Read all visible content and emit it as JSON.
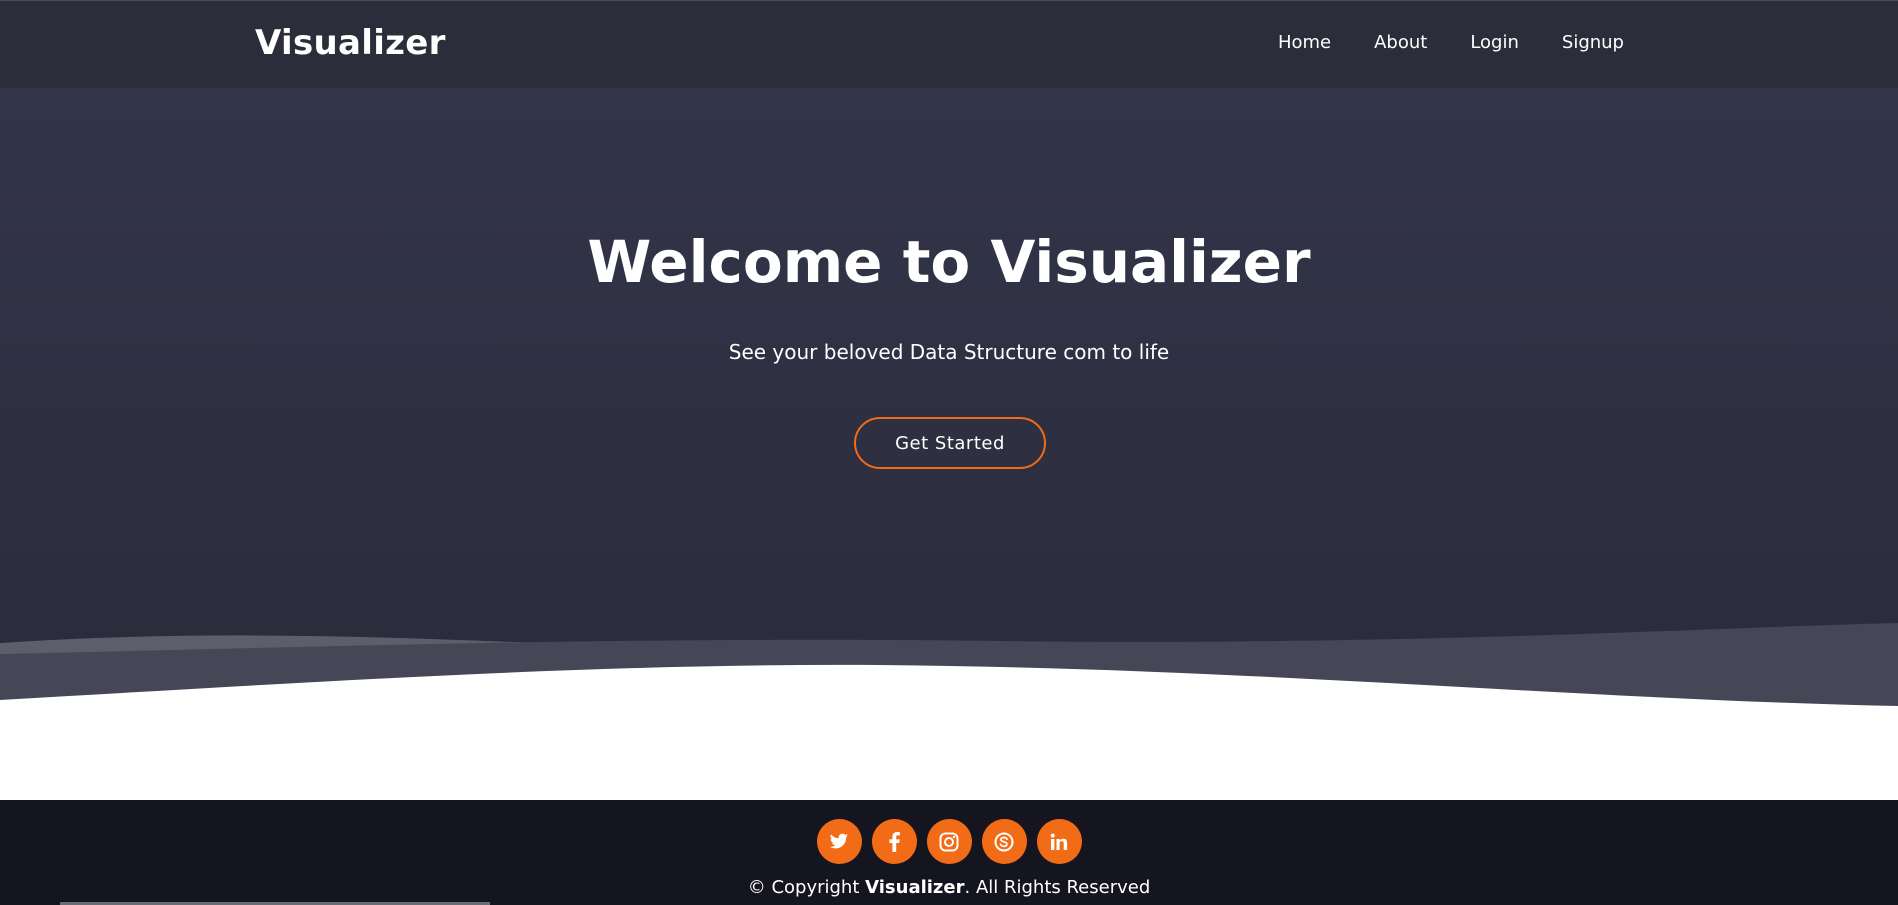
{
  "header": {
    "logo": "Visualizer",
    "nav": [
      {
        "label": "Home"
      },
      {
        "label": "About"
      },
      {
        "label": "Login"
      },
      {
        "label": "Signup"
      }
    ]
  },
  "hero": {
    "title": "Welcome to Visualizer",
    "subtitle": "See your beloved Data Structure com to life",
    "cta_label": "Get Started"
  },
  "footer": {
    "socials": [
      {
        "icon": "twitter-icon"
      },
      {
        "icon": "facebook-icon"
      },
      {
        "icon": "instagram-icon"
      },
      {
        "icon": "skype-icon"
      },
      {
        "icon": "linkedin-icon"
      }
    ],
    "copyright_prefix": "© Copyright ",
    "copyright_brand": "Visualizer",
    "copyright_suffix": ". All Rights Reserved"
  },
  "colors": {
    "accent": "#f26b16",
    "header_bg": "#2c2d3b",
    "hero_bg": "#2d2e3f",
    "footer_bg": "#151520"
  }
}
